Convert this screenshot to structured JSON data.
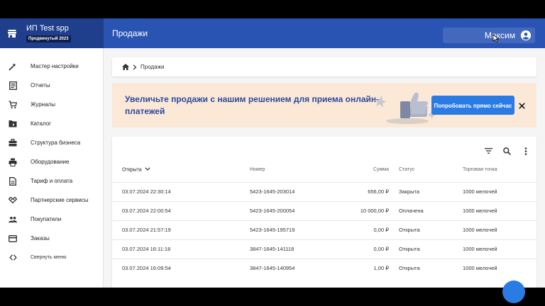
{
  "brand": {
    "title": "ИП Test spp",
    "badge": "Продвинутый 2023"
  },
  "header": {
    "title": "Продажи",
    "user_name": "Максим"
  },
  "sidebar": {
    "items": [
      {
        "label": "Мастер настройки",
        "icon": "magic-wand-icon"
      },
      {
        "label": "Отчеты",
        "icon": "report-icon"
      },
      {
        "label": "Журналы",
        "icon": "cart-icon"
      },
      {
        "label": "Каталог",
        "icon": "folder-icon"
      },
      {
        "label": "Структура бизнеса",
        "icon": "briefcase-icon"
      },
      {
        "label": "Оборудование",
        "icon": "printer-icon"
      },
      {
        "label": "Тариф и оплата",
        "icon": "document-icon"
      },
      {
        "label": "Партнерские сервисы",
        "icon": "handshake-icon"
      },
      {
        "label": "Покупатели",
        "icon": "people-icon"
      },
      {
        "label": "Заказы",
        "icon": "card-icon"
      }
    ],
    "collapse_label": "Свернуть меню"
  },
  "breadcrumb": {
    "label": "Продажи"
  },
  "promo": {
    "text": "Увеличьте продажи с нашим решением для приема онлайн-платежей",
    "button_label": "Попробовать прямо сейчас"
  },
  "table": {
    "columns": [
      "Открыта",
      "Номер",
      "Сумма",
      "Статус",
      "Торговая точка"
    ],
    "rows": [
      [
        "03.07.2024 22:30:14",
        "5423-1645-203014",
        "656,00 ₽",
        "Закрыта",
        "1000 мелочей"
      ],
      [
        "03.07.2024 22:00:54",
        "5423-1645-200054",
        "10 000,00 ₽",
        "Оплачена",
        "1000 мелочей"
      ],
      [
        "03.07.2024 21:57:19",
        "5423-1645-195719",
        "0,00 ₽",
        "Открыта",
        "1000 мелочей"
      ],
      [
        "03.07.2024 16:11:18",
        "3847-1645-141118",
        "0,00 ₽",
        "Открыта",
        "1000 мелочей"
      ],
      [
        "03.07.2024 16:09:54",
        "3847-1645-140954",
        "1,00 ₽",
        "Открыта",
        "1000 мелочей"
      ]
    ]
  },
  "colors": {
    "header": "#2a54b3",
    "brand": "#1f3f8c",
    "accent": "#2a7be4",
    "promo_bg": "#fbe8d6",
    "promo_text": "#2a4a9c"
  }
}
